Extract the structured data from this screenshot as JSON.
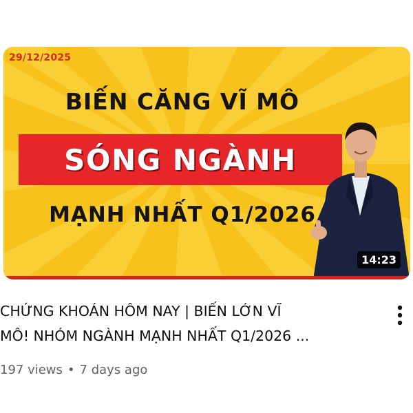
{
  "thumbnail": {
    "date": "29/12/2025",
    "line1": "BIẾN CĂNG VĨ MÔ",
    "banner": "SÓNG NGÀNH",
    "line3": "MẠNH NHẤT Q1/2026",
    "duration": "14:23"
  },
  "video": {
    "title": "CHỨNG KHOÁN HÔM NAY | BIẾN LỚN VĨ\nMÔ! NHÓM NGÀNH MẠNH NHẤT Q1/2026 ...",
    "views": "197 views",
    "separator": "•",
    "age": "7 days ago"
  },
  "icons": {
    "more": "more-vert-icon"
  },
  "colors": {
    "thumbnail_bg": "#f8c21c",
    "banner_red": "#e7262a",
    "date_red": "#d52a1c",
    "title_text": "#0f0f0f",
    "meta_text": "#606060"
  }
}
